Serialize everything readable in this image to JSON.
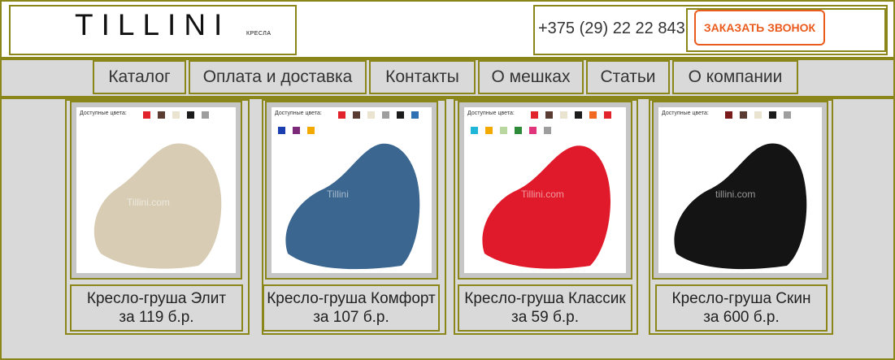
{
  "header": {
    "logo_text": "TILLINI",
    "logo_sub": "КРЕСЛА",
    "phone": "+375 (29) 22 22 843",
    "callback_label": "ЗАКАЗАТЬ ЗВОНОК"
  },
  "nav": [
    {
      "label": "Каталог"
    },
    {
      "label": "Оплата и доставка"
    },
    {
      "label": "Контакты"
    },
    {
      "label": "О мешках"
    },
    {
      "label": "Статьи"
    },
    {
      "label": "О компании"
    }
  ],
  "products": [
    {
      "colors_label": "Доступные цвета:",
      "watermark": "Tillini.com",
      "name": "Кресло-груша Элит",
      "price": "за 119 б.р.",
      "bag_color": "#d8cdb4",
      "swatches": [
        "#e1232b",
        "#5a3c32",
        "#e9e3cf",
        "#1c1c1c",
        "#9e9e9e"
      ]
    },
    {
      "colors_label": "Доступные цвета:",
      "watermark": "Tillini",
      "name": "Кресло-груша Комфорт",
      "price": "за 107 б.р.",
      "bag_color": "#3a6690",
      "swatches": [
        "#e1232b",
        "#5a3c32",
        "#e9e3cf",
        "#9e9e9e",
        "#1c1c1c",
        "#2f6fb3",
        "#1b3fb0",
        "#7d2a7a",
        "#f2a900"
      ]
    },
    {
      "colors_label": "Доступные цвета:",
      "watermark": "Tillini.com",
      "name": "Кресло-груша Классик",
      "price": "за 59 б.р.",
      "bag_color": "#e01a2a",
      "swatches": [
        "#e1232b",
        "#5a3c32",
        "#e9e3cf",
        "#1c1c1c",
        "#f26a21",
        "#e1232b",
        "#1fb6d8",
        "#f2a900",
        "#b8d8a0",
        "#2e8b3a",
        "#e0357a",
        "#9e9e9e"
      ]
    },
    {
      "colors_label": "Доступные цвета:",
      "watermark": "tillini.com",
      "name": "Кресло-груша Скин",
      "price": "за 600 б.р.",
      "bag_color": "#141414",
      "swatches": [
        "#7a1b1b",
        "#5a3c32",
        "#e9e3cf",
        "#1c1c1c",
        "#9e9e9e"
      ]
    }
  ]
}
